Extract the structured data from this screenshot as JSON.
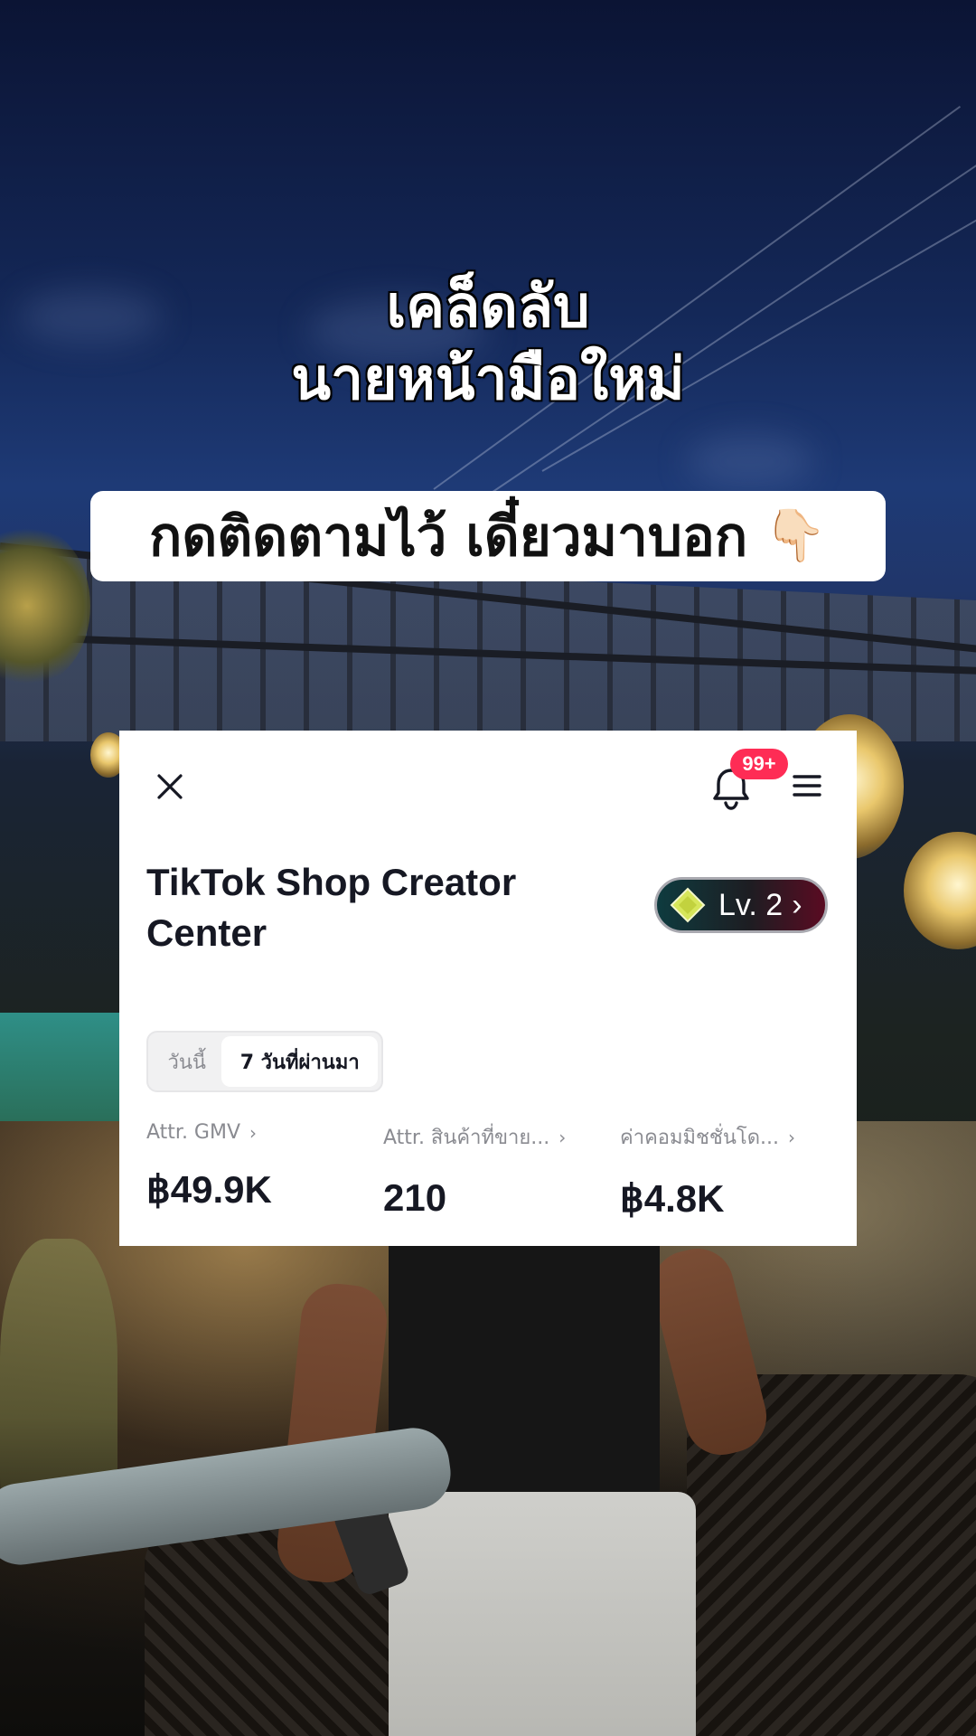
{
  "overlay": {
    "headline_line1": "เคล็ดลับ",
    "headline_line2": "นายหน้ามือใหม่",
    "follow_banner": "กดติดตามไว้ เดี๋ยวมาบอก",
    "pointing_emoji": "👇🏻"
  },
  "card": {
    "notification_badge": "99+",
    "title": "TikTok Shop Creator Center",
    "level": {
      "label": "Lv. 2",
      "chevron": "›"
    },
    "period_tabs": [
      {
        "label": "วันนี้",
        "selected": false
      },
      {
        "label": "7 วันที่ผ่านมา",
        "selected": true
      }
    ],
    "metrics": [
      {
        "label": "Attr. GMV",
        "value": "฿49.9K"
      },
      {
        "label": "Attr. สินค้าที่ขาย...",
        "value": "210"
      },
      {
        "label": "ค่าคอมมิชชั่นโด...",
        "value": "฿4.8K"
      }
    ],
    "metric_chevron": "›"
  },
  "icons": {
    "close": "close-icon",
    "notification": "bell-icon",
    "menu": "hamburger-menu-icon",
    "level": "diamond-icon"
  },
  "colors": {
    "badge": "#fe2c55",
    "level_pill_start": "#0e3b3f",
    "level_pill_end": "#5a0b22",
    "level_diamond": "#d6e65a",
    "text_primary": "#161823",
    "text_secondary": "#8a8b91"
  }
}
